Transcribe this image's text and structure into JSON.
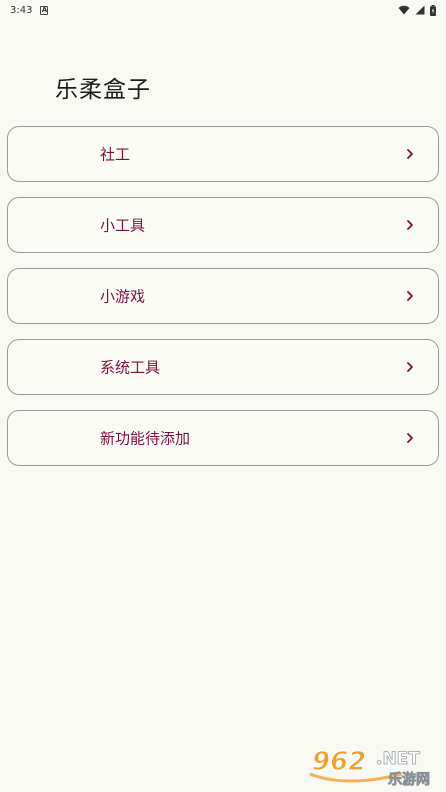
{
  "status_bar": {
    "time": "3:43"
  },
  "app": {
    "title": "乐柔盒子"
  },
  "menu": {
    "items": [
      {
        "label": "社工"
      },
      {
        "label": "小工具"
      },
      {
        "label": "小游戏"
      },
      {
        "label": "系统工具"
      },
      {
        "label": "新功能待添加"
      }
    ]
  },
  "watermark": {
    "brand_number": "962",
    "brand_suffix": ".NET",
    "brand_cn": "乐游网"
  },
  "colors": {
    "accent": "#7a1040",
    "background": "#f9f9f3",
    "border": "#9a9a9a"
  }
}
